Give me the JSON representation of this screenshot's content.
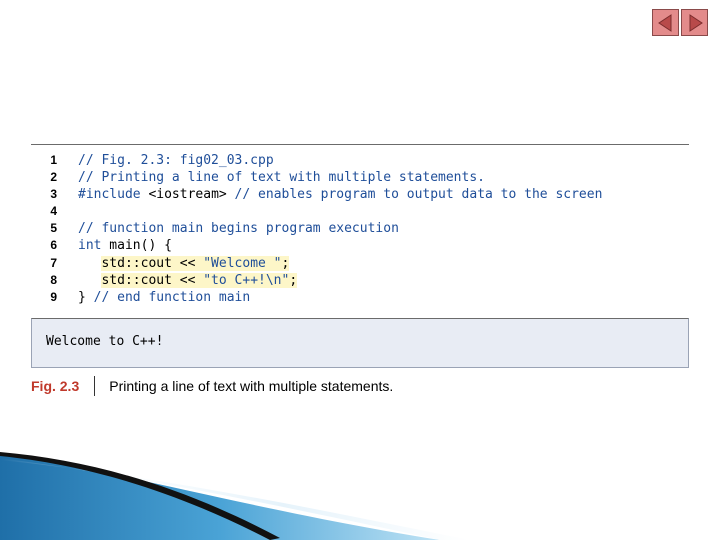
{
  "nav": {
    "prev_icon": "triangle-left-icon",
    "next_icon": "triangle-right-icon",
    "color": "#e38b8b"
  },
  "code": {
    "lines": [
      {
        "num": "1",
        "segments": [
          {
            "text": "// Fig. 2.3: fig02_03.cpp",
            "kind": "comment"
          }
        ]
      },
      {
        "num": "2",
        "segments": [
          {
            "text": "// Printing a line of text with multiple statements.",
            "kind": "comment"
          }
        ]
      },
      {
        "num": "3",
        "segments": [
          {
            "text": "#include ",
            "kind": "pp"
          },
          {
            "text": "<iostream>",
            "kind": "plain"
          },
          {
            "text": " // enables program to output data to the screen",
            "kind": "comment"
          }
        ]
      },
      {
        "num": "4",
        "segments": [
          {
            "text": "",
            "kind": "plain"
          }
        ]
      },
      {
        "num": "5",
        "segments": [
          {
            "text": "// function main begins program execution",
            "kind": "comment"
          }
        ]
      },
      {
        "num": "6",
        "segments": [
          {
            "text": "int",
            "kind": "pp"
          },
          {
            "text": " main() {",
            "kind": "plain"
          }
        ]
      },
      {
        "num": "7",
        "segments": [
          {
            "text": "   ",
            "kind": "plain"
          },
          {
            "text": "std::cout << ",
            "kind": "hl"
          },
          {
            "text": "\"Welcome \"",
            "kind": "hlstr"
          },
          {
            "text": ";",
            "kind": "hl"
          }
        ]
      },
      {
        "num": "8",
        "segments": [
          {
            "text": "   ",
            "kind": "plain"
          },
          {
            "text": "std::cout << ",
            "kind": "hl"
          },
          {
            "text": "\"to C++!\\n\"",
            "kind": "hlstr"
          },
          {
            "text": ";",
            "kind": "hl"
          }
        ]
      },
      {
        "num": "9",
        "segments": [
          {
            "text": "} ",
            "kind": "plain"
          },
          {
            "text": "// end function main",
            "kind": "comment"
          }
        ]
      }
    ]
  },
  "output": {
    "text": "Welcome to C++!"
  },
  "caption": {
    "fig_num": "Fig. 2.3",
    "text": "Printing a line of text with multiple statements."
  },
  "colors": {
    "comment": "#1f4e99",
    "highlight": "#fdf6c8",
    "fig_num": "#c0392b",
    "output_bg": "#e8ecf4"
  }
}
